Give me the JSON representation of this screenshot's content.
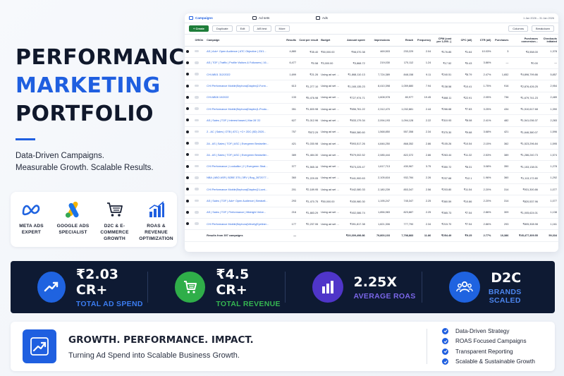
{
  "hero": {
    "line1": "PERFORMANCE",
    "line2": "MARKETING",
    "line3": "PORTFOLIO",
    "sub1": "Data-Driven Campaigns.",
    "sub2": "Measurable Growth. Scalable Results."
  },
  "badges": [
    {
      "icon": "meta-logo-icon",
      "label1": "META ADS",
      "label2": "EXPERT"
    },
    {
      "icon": "google-ads-logo-icon",
      "label1": "GOOGLE ADS",
      "label2": "SPECIALIST"
    },
    {
      "icon": "shopping-cart-icon",
      "label1": "D2C & E-COMMERCE",
      "label2": "GROWTH"
    },
    {
      "icon": "bar-chart-icon",
      "label1": "ROAS & REVENUE",
      "label2": "OPTIMIZATION"
    }
  ],
  "ads_manager": {
    "tabs": [
      "Campaigns",
      "Ad sets",
      "Ads"
    ],
    "date_range": "1 Jan 2026 – 31 Jan 2026",
    "toolbar": {
      "create": "+ Create",
      "duplicate": "Duplicate",
      "edit": "Edit",
      "ab_test": "A/B test",
      "more": "More",
      "columns": "Columns",
      "breakdown": "Breakdown"
    },
    "columns": [
      "Off/On",
      "Campaign",
      "Results",
      "Cost per result",
      "Budget",
      "Amount spent",
      "Impressions",
      "Reach",
      "Frequency",
      "CPM (cost per 1,000...)",
      "CPC (all)",
      "CTR (all)",
      "Purchases",
      "Purchases conversion...",
      "Checkouts initiated"
    ],
    "rows": [
      {
        "campaign": "AS | Adv+ Open Audience | ATC Objective | 23/1...",
        "results": "4,880",
        "cpr": "₹35.40",
        "budget": "₹50,000.00",
        "spent": "₹98,070.38",
        "impr": "469,503",
        "reach": "233,229",
        "freq": "2.04",
        "cpm": "₹176.85",
        "cpc": "₹1.64",
        "ctr": "10.03%",
        "purch": "3",
        "pconv": "₹3,558.00",
        "checkouts": "1,378"
      },
      {
        "campaign": "AS | TOF | Traffic | Profile Visitors & Followers | 16...",
        "results": "6,477",
        "cpr": "₹0.58",
        "budget": "₹3,000.00",
        "spent": "₹3,868.72",
        "impr": "219,030",
        "reach": "170,112",
        "freq": "1.24",
        "cpm": "₹17.52",
        "cpc": "₹0.43",
        "ctr": "3.86%",
        "purch": "—",
        "pconv": "₹0.00",
        "checkouts": "—"
      },
      {
        "campaign": "CHI AB01 312/2022",
        "results": "1,699",
        "cpr": "₹21.26",
        "budget": "Using ad set bud...",
        "spent": "₹1,868,110.13",
        "impr": "7,724,389",
        "reach": "848,158",
        "freq": "9.11",
        "cpm": "₹240.51",
        "cpc": "₹8.79",
        "ctr": "2.47%",
        "purch": "1,652",
        "pconv": "₹4,896,799.86",
        "checkouts": "5,857"
      },
      {
        "campaign": "CHI Performance Mobile|Sephora|Diaplex|2-Form...",
        "results": "613",
        "cpr": "₹1,277.10",
        "budget": "Using ad set bud...",
        "spent": "₹1,165,135.23",
        "impr": "8,410,398",
        "reach": "1,059,880",
        "freq": "7.94",
        "cpm": "₹138.58",
        "cpc": "₹10.41",
        "ctr": "1.75%",
        "purch": "916",
        "pconv": "₹2,876,426.25",
        "checkouts": "2,954"
      },
      {
        "campaign": "CHI AB08 10/2022",
        "results": "133",
        "cpr": "₹5,476.98",
        "budget": "Using ad set bud...",
        "spent": "₹727,974.71",
        "impr": "1,608,978",
        "reach": "80,977",
        "freq": "19.45",
        "cpm": "₹468.11",
        "cpc": "₹22.91",
        "ctr": "2.05%",
        "purch": "736",
        "pconv": "₹1,679,741.23",
        "checkouts": "2,489"
      },
      {
        "campaign": "CHI Performance Mobile|Sephora|Diaplex|1-Produ...",
        "results": "351",
        "cpr": "₹1,600.98",
        "budget": "Using ad set bud...",
        "spent": "₹656,761.22",
        "impr": "2,312,470",
        "reach": "1,032,881",
        "freq": "2.44",
        "cpm": "₹266.68",
        "cpc": "₹7.83",
        "ctr": "3.25%",
        "purch": "434",
        "pconv": "₹1,510,617.68",
        "checkouts": "1,390"
      },
      {
        "campaign": "AS | Sales | TOF | Interest based | Mar 28 '22",
        "results": "627",
        "cpr": "₹1,012.96",
        "budget": "Using ad set bud...",
        "spent": "₹633,179.34",
        "impr": "2,094,193",
        "reach": "1,094,128",
        "freq": "2.22",
        "cpm": "₹310.93",
        "cpc": "₹8.08",
        "ctr": "2.41%",
        "purch": "482",
        "pconv": "₹1,541,036.37",
        "checkouts": "2,283"
      },
      {
        "campaign": "2 - AC | Sales | OTB | ATC | +C+ 2DC (8D) 2020...",
        "results": "757",
        "cpr": "₹872.29",
        "budget": "Using ad set bud...",
        "spent": "₹660,380.60",
        "impr": "1,568,850",
        "reach": "557,358",
        "freq": "2.34",
        "cpm": "₹375.30",
        "cpc": "₹9.68",
        "ctr": "3.68%",
        "purch": "421",
        "pconv": "₹1,646,380.07",
        "checkouts": "1,596"
      },
      {
        "campaign": "2A - AS | Sales | TOF | ASC | Evergreen Bestseller...",
        "results": "421",
        "cpr": "₹1,030.98",
        "budget": "Using ad set bud...",
        "spent": "₹593,517.26",
        "impr": "4,846,250",
        "reach": "868,352",
        "freq": "2.86",
        "cpm": "₹105.26",
        "cpc": "₹10.54",
        "ctr": "2.15%",
        "purch": "362",
        "pconv": "₹1,523,296.84",
        "checkouts": "1,595"
      },
      {
        "campaign": "2A - AS | Sales | TOF | ASC | Evergreen Bestseller...",
        "results": "389",
        "cpr": "₹1,484.30",
        "budget": "Using ad set bud...",
        "spent": "₹579,002.52",
        "impr": "2,085,444",
        "reach": "822,372",
        "freq": "2.86",
        "cpm": "₹263.44",
        "cpc": "₹11.32",
        "ctr": "2.53%",
        "purch": "389",
        "pconv": "₹1,286,240.73",
        "checkouts": "1,574"
      },
      {
        "campaign": "CHI Performance | Lookalike | 2 | Evergreen Strat...",
        "results": "377",
        "cpr": "₹1,565.16",
        "budget": "Using ad set bud...",
        "spent": "₹573,225.47",
        "impr": "1,617,713",
        "reach": "430,967",
        "freq": "3.75",
        "cpm": "₹350.72",
        "cpc": "₹8.31",
        "ctr": "3.08%",
        "purch": "350",
        "pconv": "₹1,153,138.01",
        "checkouts": "1,278"
      },
      {
        "campaign": "NBA | ABO ASR | B2BE 375 | 3RV | Bug_2872077...",
        "results": "360",
        "cpr": "₹1,229.05",
        "budget": "Using ad set bud...",
        "spent": "₹441,900.63",
        "impr": "2,105,616",
        "reach": "932,784",
        "freq": "2.26",
        "cpm": "₹237.68",
        "cpc": "₹12.1",
        "ctr": "1.96%",
        "purch": "360",
        "pconv": "₹1,113,172.80",
        "checkouts": "1,292"
      },
      {
        "campaign": "CHI Performance Mobile|Sephora|Diaplex|2-Lumi...",
        "results": "201",
        "cpr": "₹2,189.95",
        "budget": "Using ad set bud...",
        "spent": "₹442,080.33",
        "impr": "2,180,239",
        "reach": "853,347",
        "freq": "2.56",
        "cpm": "₹203.80",
        "cpc": "₹11.54",
        "ctr": "2.20%",
        "purch": "314",
        "pconv": "₹931,300.86",
        "checkouts": "1,077"
      },
      {
        "campaign": "AS | Sales | TOF | Adv+ Open Audience | Bestsell...",
        "results": "293",
        "cpr": "₹1,470.75",
        "budget": "₹50,000.00",
        "spent": "₹430,980.30",
        "impr": "1,195,247",
        "reach": "745,347",
        "freq": "2.25",
        "cpm": "₹360.59",
        "cpc": "₹10.86",
        "ctr": "2.20%",
        "purch": "314",
        "pconv": "₹820,537.96",
        "checkouts": "1,077"
      },
      {
        "campaign": "AS | Sales | TOF | Performance | Midnight Velve...",
        "results": "216",
        "cpr": "₹1,883.29",
        "budget": "Using ad set bud...",
        "spent": "₹402,086.74",
        "impr": "1,856,983",
        "reach": "823,887",
        "freq": "2.25",
        "cpm": "₹365.73",
        "cpc": "₹7.54",
        "ctr": "2.86%",
        "purch": "309",
        "pconv": "₹1,005,624.01",
        "checkouts": "1,138"
      },
      {
        "campaign": "CHI Performance Mobile|Sephora|Velvety|Eyeliner...",
        "results": "177",
        "cpr": "₹2,237.06",
        "budget": "Using ad set bud...",
        "spent": "₹391,817.38",
        "impr": "1,821,306",
        "reach": "777,790",
        "freq": "2.34",
        "cpm": "₹215.70",
        "cpc": "₹7.54",
        "ctr": "2.86%",
        "purch": "293",
        "pconv": "₹805,308.98",
        "checkouts": "1,161"
      }
    ],
    "totals": {
      "label": "Results from 397 campaigns",
      "results": "—",
      "spent": "₹20,309,498.86",
      "impr": "79,800,103",
      "reach": "7,798,883",
      "freq": "11.86",
      "cpm": "₹254.49",
      "cpc": "₹9.25",
      "ctr": "2.77%",
      "purch": "10,386",
      "pconv": "₹45,477,309.55",
      "checkouts": "59,334"
    }
  },
  "stats": [
    {
      "icon": "trend-up-icon",
      "value": "₹2.03 CR+",
      "label": "TOTAL AD SPEND",
      "circle": "#1f63e0",
      "accent": "#3b7cf0"
    },
    {
      "icon": "cart-icon",
      "value": "₹4.5 CR+",
      "label": "TOTAL REVENUE",
      "circle": "#2fae49",
      "accent": "#35b651"
    },
    {
      "icon": "bar-chart-icon",
      "value": "2.25X",
      "label": "AVERAGE ROAS",
      "circle": "#4f35c9",
      "accent": "#7a66e8"
    },
    {
      "icon": "people-icon",
      "value": "D2C",
      "label": "BRANDS SCALED",
      "circle": "#1f63e0",
      "accent": "#4c86ef"
    }
  ],
  "growth": {
    "title": "GROWTH. PERFORMANCE. IMPACT.",
    "subtitle": "Turning Ad Spend into Scalable Business Growth.",
    "checks": [
      "Data-Driven Strategy",
      "ROAS Focused Campaigns",
      "Transparent Reporting",
      "Scalable & Sustainable Growth"
    ]
  }
}
